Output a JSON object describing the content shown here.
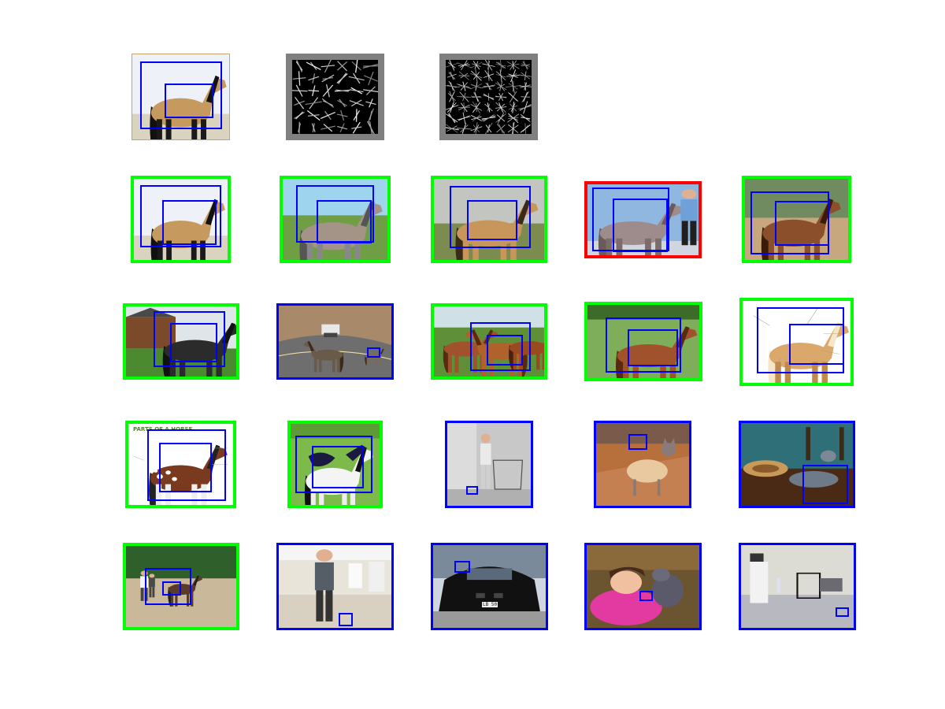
{
  "figure": {
    "rows": [
      {
        "row": "query",
        "panels": [
          {
            "name": "query-image",
            "scene": "horse-buckskin",
            "frame": "tan",
            "boxes": 2
          },
          {
            "name": "feature-visualization-1",
            "scene": "hog-sparse",
            "frame": "gray",
            "boxes": 0
          },
          {
            "name": "feature-visualization-2",
            "scene": "hog-dense",
            "frame": "gray",
            "boxes": 0
          }
        ]
      },
      {
        "row": "results-1",
        "panels": [
          {
            "name": "result-1",
            "scene": "horse-buckskin",
            "frame": "green",
            "boxes": 2
          },
          {
            "name": "result-2",
            "scene": "horse-grey-field",
            "frame": "green",
            "boxes": 2
          },
          {
            "name": "result-3",
            "scene": "horse-dun",
            "frame": "green",
            "boxes": 2
          },
          {
            "name": "result-4",
            "scene": "horse-dapple-with-handler",
            "frame": "red",
            "boxes": 2
          },
          {
            "name": "result-5",
            "scene": "horse-bay-arena",
            "frame": "green",
            "boxes": 2
          }
        ]
      },
      {
        "row": "results-2",
        "panels": [
          {
            "name": "result-6",
            "scene": "horse-black-farm",
            "frame": "green",
            "boxes": 2
          },
          {
            "name": "result-7",
            "scene": "road-animals",
            "frame": "blue",
            "boxes": 1
          },
          {
            "name": "result-8",
            "scene": "horses-herd",
            "frame": "green",
            "boxes": 2
          },
          {
            "name": "result-9",
            "scene": "horse-chestnut-pasture",
            "frame": "green",
            "boxes": 2
          },
          {
            "name": "result-10",
            "scene": "horse-palomino-diagram",
            "frame": "green",
            "boxes": 2
          }
        ]
      },
      {
        "row": "results-3",
        "panels": [
          {
            "name": "result-11",
            "scene": "horse-appaloosa-diagram",
            "frame": "green",
            "boxes": 2,
            "caption": "PARTS OF A HORSE"
          },
          {
            "name": "result-12",
            "scene": "horse-paint",
            "frame": "green",
            "boxes": 2
          },
          {
            "name": "result-13",
            "scene": "woman-on-chair",
            "frame": "blue",
            "boxes": 1
          },
          {
            "name": "result-14",
            "scene": "cat-in-sweater",
            "frame": "blue",
            "boxes": 1
          },
          {
            "name": "result-15",
            "scene": "cat-on-table",
            "frame": "blue",
            "boxes": 1
          }
        ]
      },
      {
        "row": "results-4",
        "panels": [
          {
            "name": "result-16",
            "scene": "horse-paddock-riders",
            "frame": "green",
            "boxes": 2
          },
          {
            "name": "result-17",
            "scene": "man-in-kitchen",
            "frame": "blue",
            "boxes": 1
          },
          {
            "name": "result-18",
            "scene": "car-front",
            "frame": "blue",
            "boxes": 1,
            "plate": "LB 50"
          },
          {
            "name": "result-19",
            "scene": "girl-with-cat",
            "frame": "blue",
            "boxes": 1
          },
          {
            "name": "result-20",
            "scene": "room-chairs",
            "frame": "blue",
            "boxes": 1
          }
        ]
      }
    ],
    "colors": {
      "correct_frame": "#00ff00",
      "wrong_frame": "#ff0000",
      "other_frame": "#0000ff",
      "detection_box": "#0000ff",
      "feature_border": "#808080"
    }
  }
}
